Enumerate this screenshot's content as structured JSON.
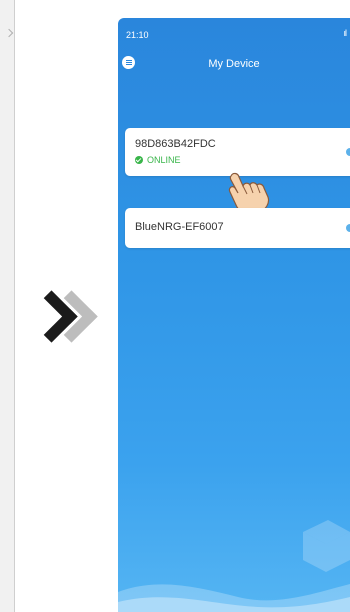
{
  "status_bar": {
    "time": "21:10",
    "signal": "..."
  },
  "header": {
    "title": "My Device"
  },
  "devices": [
    {
      "name": "98D863B42FDC",
      "status": "ONLINE"
    },
    {
      "name": "BlueNRG-EF6007"
    }
  ],
  "colors": {
    "accent": "#2a86dc",
    "online": "#39b54a",
    "card": "#ffffff"
  },
  "icons": {
    "menu": "menu-icon",
    "next": "chevron-right-icon",
    "pointer": "hand-pointer-icon"
  }
}
